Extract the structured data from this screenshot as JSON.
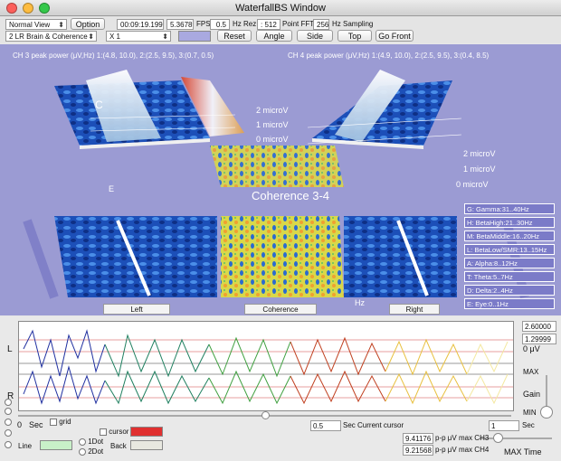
{
  "window": {
    "title": "WaterfallBS Window"
  },
  "toolbar": {
    "view_select": "Normal View",
    "option_button": "Option",
    "time": "00:09:19.199",
    "fps_value": "5.36789",
    "fps_label": "FPS",
    "hz_rez_value": "0.5",
    "hz_rez_label": "Hz Rez",
    "fft_value": ": 512",
    "fft_label": "Point FFT",
    "sampling_value": "256",
    "sampling_label": "Hz Sampling",
    "mode_select": "2 LR Brain & Coherence",
    "scale_select": "X 1",
    "buttons": [
      "Reset",
      "Angle",
      "Side",
      "Top",
      "Go Front"
    ]
  },
  "viewport": {
    "ch3_title": "CH 3 peak power (μV,Hz) 1:(4.8, 10.0), 2:(2.5, 9.5), 3:(0.7, 0.5)",
    "ch4_title": "CH 4 peak power (μV,Hz) 1:(4.9, 10.0), 2:(2.5, 9.5), 3:(0.4, 8.5)",
    "coherence_label": "Coherence 3-4",
    "microv_labels": [
      "2 microV",
      "1 microV",
      "0 microV",
      "2 microV",
      "1 microV",
      "0 microV"
    ],
    "axis_letters": [
      "C",
      "E",
      "Hz"
    ],
    "legend": [
      "G: Gamma:31..40Hz",
      "H: BetaHigh:21..30Hz",
      "M: BetaMiddle:16..20Hz",
      "L: BetaLow/SMR:13..15Hz",
      "A: Alpha:8..12Hz",
      "T: Theta:5..7Hz",
      "D: Delta:2..4Hz",
      "E: Eye:0..1Hz"
    ],
    "bottom_buttons": [
      "Left",
      "Coherence",
      "Right"
    ]
  },
  "eeg": {
    "side_letters": [
      "L",
      "R"
    ],
    "scale_top": "2.60000",
    "scale_mid": "1.29999",
    "scale_unit": "0 μV",
    "gain_label": "Gain",
    "max_label": "MAX",
    "min_label": "MIN",
    "sec_label": "Sec",
    "sec_value": "0",
    "grid_label": "grid",
    "cursor_label": "cursor",
    "line_label": "Line",
    "back_label": "Back",
    "dot1_label": "1Dot",
    "dot2_label": "2Dot",
    "cursor_sec_value": "0.5",
    "cursor_sec_label": "Sec Current cursor",
    "max_time_value": "1",
    "max_time_unit": "Sec",
    "max_time_label": "MAX Time",
    "ch3_max": "9.41176",
    "ch3_label": "p-p μV max CH3",
    "ch4_max": "9.21568",
    "ch4_label": "p-p μV max CH4",
    "colors": {
      "cursor": "#e03030",
      "line": "#c8f0c8",
      "back": "#e8e8e0"
    }
  }
}
